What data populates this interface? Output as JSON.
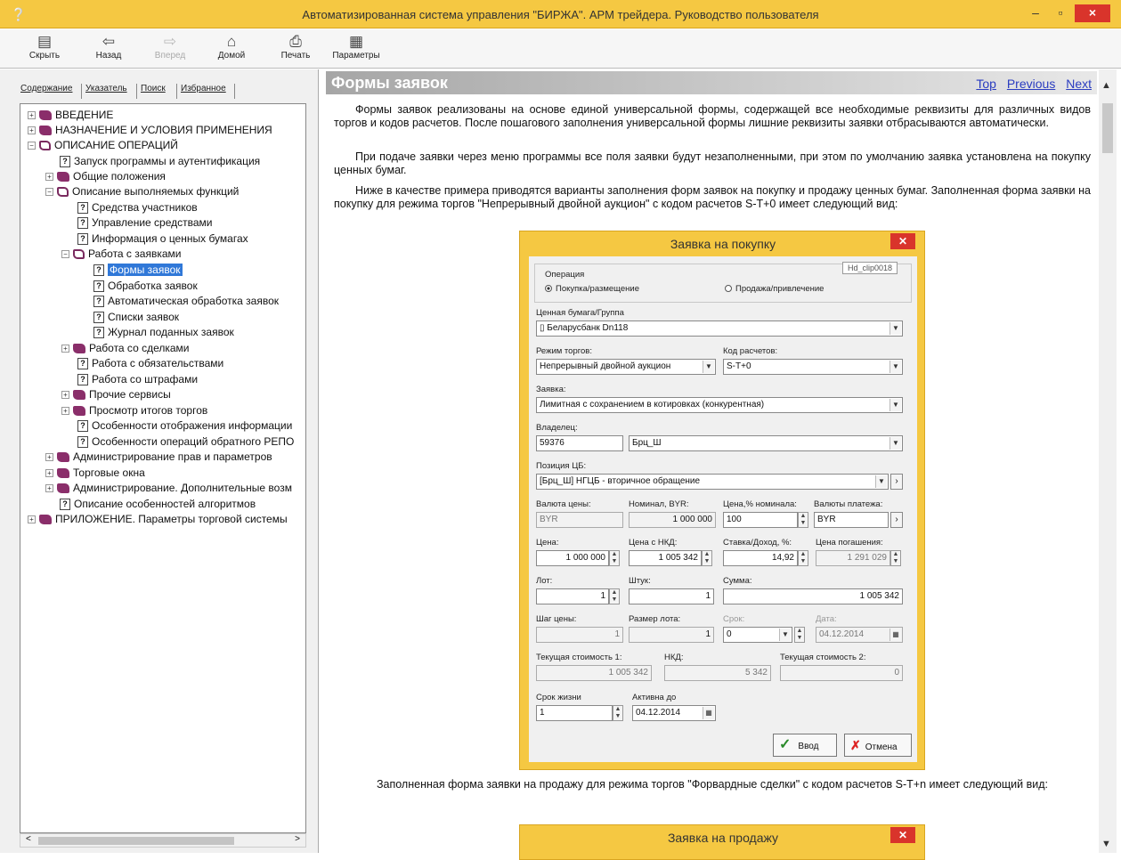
{
  "window": {
    "title": "Автоматизированная система управления \"БИРЖА\". АРМ трейдера. Руководство пользователя",
    "app_icon": "help-question-icon",
    "min": "–",
    "max": "▫",
    "close": "×"
  },
  "toolbar": {
    "hide": "Скрыть",
    "back": "Назад",
    "forward": "Вперед",
    "home": "Домой",
    "print": "Печать",
    "options": "Параметры"
  },
  "nav_tabs": [
    "Содержание",
    "Указатель",
    "Поиск",
    "Избранное"
  ],
  "tree": {
    "items": [
      "ВВЕДЕНИЕ",
      "НАЗНАЧЕНИЕ И УСЛОВИЯ ПРИМЕНЕНИЯ",
      "ОПИСАНИЕ ОПЕРАЦИЙ",
      "Запуск программы и аутентификация",
      "Общие положения",
      "Описание выполняемых функций",
      "Средства участников",
      "Управление средствами",
      "Информация о ценных бумагах",
      "Работа с заявками",
      "Формы заявок",
      "Обработка заявок",
      "Автоматическая обработка заявок",
      "Списки заявок",
      "Журнал поданных заявок",
      "Работа со сделками",
      "Работа с обязательствами",
      "Работа со штрафами",
      "Прочие сервисы",
      "Просмотр итогов торгов",
      "Особенности отображения информации",
      "Особенности операций обратного РЕПО",
      "Администрирование прав и параметров",
      "Торговые окна",
      "Администрирование. Дополнительные возм",
      "Описание особенностей алгоритмов",
      "ПРИЛОЖЕНИЕ. Параметры торговой системы"
    ]
  },
  "topic": {
    "title": "Формы заявок",
    "nav": [
      "Top",
      "Previous",
      "Next"
    ],
    "p1": "Формы заявок реализованы на основе единой универсальной формы, содержащей все необходимые реквизиты для различных видов торгов и кодов расчетов. После пошагового заполнения универсальной формы лишние реквизиты заявки отбрасываются автоматически.",
    "p2": "При подаче заявки через меню программы все поля заявки будут незаполненными, при этом по умолчанию заявка установлена на покупку ценных бумаг.",
    "p3": "Ниже в качестве примера приводятся варианты заполнения форм заявок на покупку и продажу ценных бумаг. Заполненная форма заявки на покупку для режима торгов \"Непрерывный двойной аукцион\" с кодом расчетов S-T+0 имеет следующий вид:",
    "p4": "Заполненная форма заявки на продажу для режима торгов \"Форвардные сделки\" с кодом расчетов S-T+n имеет следующий вид:"
  },
  "buy_dialog": {
    "title": "Заявка на покупку",
    "tooltip": "Hd_clip0018",
    "operation_label": "Операция",
    "radio_buy": "Покупка/размещение",
    "radio_sell": "Продажа/привлечение",
    "security_label": "Ценная бумага/Группа",
    "security_value": "Беларусбанк Dn118",
    "mode_label": "Режим торгов:",
    "mode_value": "Непрерывный двойной аукцион",
    "code_label": "Код расчетов:",
    "code_value": "S-T+0",
    "order_label": "Заявка:",
    "order_value": "Лимитная с сохранением в котировках (конкурентная)",
    "owner_label": "Владелец:",
    "owner_id": "59376",
    "owner_name": "Брц_Ш",
    "position_label": "Позиция ЦБ:",
    "position_value": "[Брц_Ш] НГЦБ - вторичное обращение",
    "curr_label": "Валюта цены:",
    "curr_value": "BYR",
    "nominal_label": "Номинал, BYR:",
    "nominal_value": "1 000 000",
    "pricepct_label": "Цена,% номинала:",
    "pricepct_value": "100",
    "paycurr_label": "Валюты платежа:",
    "paycurr_value": "BYR",
    "price_label": "Цена:",
    "price_value": "1 000 000",
    "pricenkd_label": "Цена с НКД:",
    "pricenkd_value": "1 005 342",
    "rate_label": "Ставка/Доход, %:",
    "rate_value": "14,92",
    "redeem_label": "Цена погашения:",
    "redeem_value": "1 291 029",
    "lot_label": "Лот:",
    "lot_value": "1",
    "qty_label": "Штук:",
    "qty_value": "1",
    "sum_label": "Сумма:",
    "sum_value": "1 005 342",
    "step_label": "Шаг цены:",
    "step_value": "1",
    "lotsize_label": "Размер лота:",
    "lotsize_value": "1",
    "term_label": "Срок:",
    "term_value": "0",
    "date_label": "Дата:",
    "date_value": "04.12.2014",
    "curcost1_label": "Текущая стоимость 1:",
    "curcost1_value": "1 005 342",
    "nkd_label": "НКД:",
    "nkd_value": "5 342",
    "curcost2_label": "Текущая стоимость 2:",
    "curcost2_value": "0",
    "life_label": "Срок жизни",
    "life_value": "1",
    "active_label": "Активна до",
    "active_value": "04.12.2014",
    "ok": "Ввод",
    "cancel": "Отмена"
  },
  "sell_dialog": {
    "title": "Заявка на продажу"
  }
}
